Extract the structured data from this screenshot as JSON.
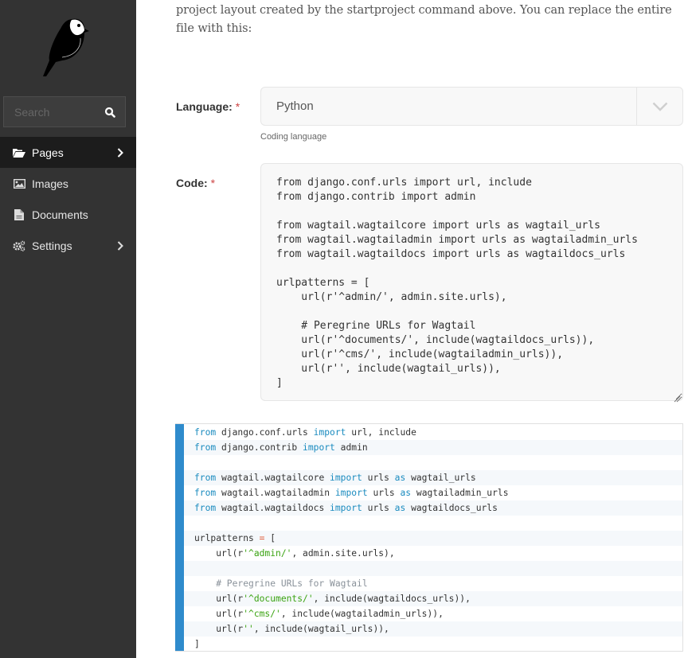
{
  "sidebar": {
    "logo": "wagtail-bird-logo",
    "search": {
      "placeholder": "Search",
      "value": "",
      "icon": "search-icon"
    },
    "items": [
      {
        "label": "Pages",
        "icon": "folder-open-icon",
        "active": true,
        "has_submenu": true
      },
      {
        "label": "Images",
        "icon": "image-icon",
        "active": false,
        "has_submenu": false
      },
      {
        "label": "Documents",
        "icon": "document-icon",
        "active": false,
        "has_submenu": false
      },
      {
        "label": "Settings",
        "icon": "cogs-icon",
        "active": false,
        "has_submenu": true
      }
    ]
  },
  "main": {
    "intro_text": "project layout created by the startproject command above. You can replace the entire file with this:",
    "language_field": {
      "label": "Language:",
      "required_marker": "*",
      "value": "Python",
      "help_text": "Coding language"
    },
    "code_field": {
      "label": "Code:",
      "required_marker": "*",
      "value": "from django.conf.urls import url, include\nfrom django.contrib import admin\n\nfrom wagtail.wagtailcore import urls as wagtail_urls\nfrom wagtail.wagtailadmin import urls as wagtailadmin_urls\nfrom wagtail.wagtaildocs import urls as wagtaildocs_urls\n\nurlpatterns = [\n    url(r'^admin/', admin.site.urls),\n\n    # Peregrine URLs for Wagtail\n    url(r'^documents/', include(wagtaildocs_urls)),\n    url(r'^cms/', include(wagtailadmin_urls)),\n    url(r'', include(wagtail_urls)),\n]"
    },
    "preview_lines": [
      [
        [
          "kw",
          "from"
        ],
        [
          "t",
          " django.conf.urls "
        ],
        [
          "kw",
          "import"
        ],
        [
          "t",
          " url, include"
        ]
      ],
      [
        [
          "kw",
          "from"
        ],
        [
          "t",
          " django.contrib "
        ],
        [
          "kw",
          "import"
        ],
        [
          "t",
          " admin"
        ]
      ],
      [],
      [
        [
          "kw",
          "from"
        ],
        [
          "t",
          " wagtail.wagtailcore "
        ],
        [
          "kw",
          "import"
        ],
        [
          "t",
          " urls "
        ],
        [
          "kw",
          "as"
        ],
        [
          "t",
          " wagtail_urls"
        ]
      ],
      [
        [
          "kw",
          "from"
        ],
        [
          "t",
          " wagtail.wagtailadmin "
        ],
        [
          "kw",
          "import"
        ],
        [
          "t",
          " urls "
        ],
        [
          "kw",
          "as"
        ],
        [
          "t",
          " wagtailadmin_urls"
        ]
      ],
      [
        [
          "kw",
          "from"
        ],
        [
          "t",
          " wagtail.wagtaildocs "
        ],
        [
          "kw",
          "import"
        ],
        [
          "t",
          " urls "
        ],
        [
          "kw",
          "as"
        ],
        [
          "t",
          " wagtaildocs_urls"
        ]
      ],
      [],
      [
        [
          "t",
          "urlpatterns "
        ],
        [
          "op",
          "="
        ],
        [
          "t",
          " ["
        ]
      ],
      [
        [
          "t",
          "    url(r"
        ],
        [
          "str",
          "'^admin/'"
        ],
        [
          "t",
          ", admin.site.urls),"
        ]
      ],
      [],
      [
        [
          "cm",
          "    # Peregrine URLs for Wagtail"
        ]
      ],
      [
        [
          "t",
          "    url(r"
        ],
        [
          "str",
          "'^documents/'"
        ],
        [
          "t",
          ", include(wagtaildocs_urls)),"
        ]
      ],
      [
        [
          "t",
          "    url(r"
        ],
        [
          "str",
          "'^cms/'"
        ],
        [
          "t",
          ", include(wagtailadmin_urls)),"
        ]
      ],
      [
        [
          "t",
          "    url(r"
        ],
        [
          "str",
          "''"
        ],
        [
          "t",
          ", include(wagtail_urls)),"
        ]
      ],
      [
        [
          "t",
          "]"
        ]
      ]
    ]
  },
  "colors": {
    "sidebar_bg": "#333333",
    "sidebar_active": "#1c1c1c",
    "accent_bar": "#2f8bcc",
    "keyword": "#1a8bbf",
    "string": "#3aa311",
    "comment": "#8a929a",
    "required": "#cd4444"
  }
}
